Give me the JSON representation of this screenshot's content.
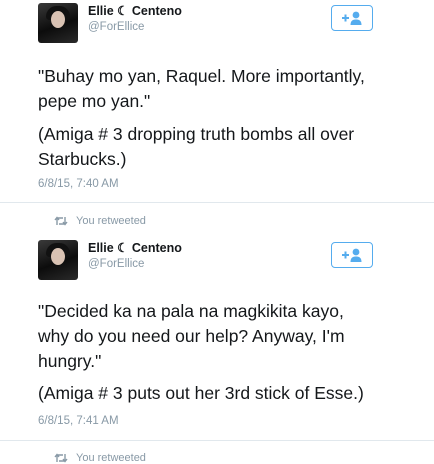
{
  "tweets": [
    {
      "name": "Ellie ☾ Centeno",
      "handle": "@ForEllice",
      "quote": "\"Buhay mo yan, Raquel. More importantly,\npepe mo yan.\"",
      "note": "(Amiga # 3 dropping truth bombs all over\nStarbucks.)",
      "timestamp": "6/8/15, 7:40 AM"
    },
    {
      "name": "Ellie ☾ Centeno",
      "handle": "@ForEllice",
      "quote": "\"Decided ka na pala na magkikita kayo,\nwhy do you need our help? Anyway, I'm\nhungry.\"",
      "note": "(Amiga # 3 puts out her 3rd stick of Esse.)",
      "timestamp": "6/8/15, 7:41 AM"
    }
  ],
  "retweet_label": "You retweeted",
  "icons": {
    "follow": "follow-add-person-icon",
    "retweet": "retweet-icon"
  },
  "colors": {
    "accent": "#55acee",
    "muted": "#8899a6",
    "divider": "#e1e8ed"
  }
}
